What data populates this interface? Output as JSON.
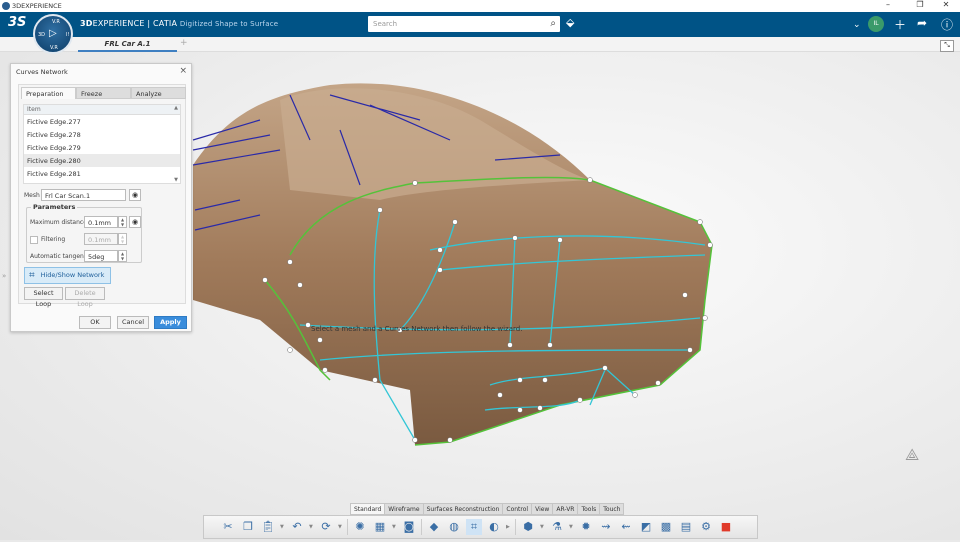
{
  "window": {
    "title": "3DEXPERIENCE",
    "controls": [
      "minimize",
      "restore",
      "close"
    ]
  },
  "header": {
    "brand_bold": "3D",
    "brand_rest": "EXPERIENCE | CATIA",
    "app_name": "Digitized Shape to Surface",
    "compass": {
      "top": "V.R",
      "left": "3D",
      "right": "I!",
      "bottom": "V.R"
    },
    "search_placeholder": "Search",
    "user_initials": "IL",
    "icons": [
      "tag-icon",
      "chevron-down-icon",
      "plus-icon",
      "share-icon",
      "help-icon"
    ]
  },
  "tabs": {
    "active": "FRL Car A.1",
    "add": "+"
  },
  "dialog": {
    "title": "Curves Network",
    "tabs": [
      "Preparation",
      "Freeze",
      "Analyze"
    ],
    "list_header": "Item",
    "items": [
      "Fictive Edge.277",
      "Fictive Edge.278",
      "Fictive Edge.279",
      "Fictive Edge.280",
      "Fictive Edge.281"
    ],
    "selected_item": "Fictive Edge.280",
    "mesh_label": "Mesh",
    "mesh_value": "Frl Car Scan.1",
    "params_title": "Parameters",
    "max_distance_label": "Maximum distance",
    "max_distance_value": "0.1mm",
    "filtering_label": "Filtering",
    "filtering_value": "0.1mm",
    "filtering_checked": false,
    "tangency_label": "Automatic tangency",
    "tangency_value": "5deg",
    "hide_show_label": "Hide/Show Network",
    "select_loop": "Select Loop",
    "delete_loop": "Delete Loop",
    "ok": "OK",
    "cancel": "Cancel",
    "apply": "Apply"
  },
  "viewport": {
    "hint": "Select a mesh and a Curves Network then follow the wizard.",
    "colors": {
      "body": "#a07a5a",
      "curve_cyan": "#33c6d6",
      "curve_green": "#55c23a",
      "curve_blue": "#2a2aa8"
    }
  },
  "action_bar": {
    "tabs": [
      "Standard",
      "Wireframe",
      "Surfaces Reconstruction",
      "Control",
      "View",
      "AR-VR",
      "Tools",
      "Touch"
    ],
    "active_tab": "Standard"
  }
}
